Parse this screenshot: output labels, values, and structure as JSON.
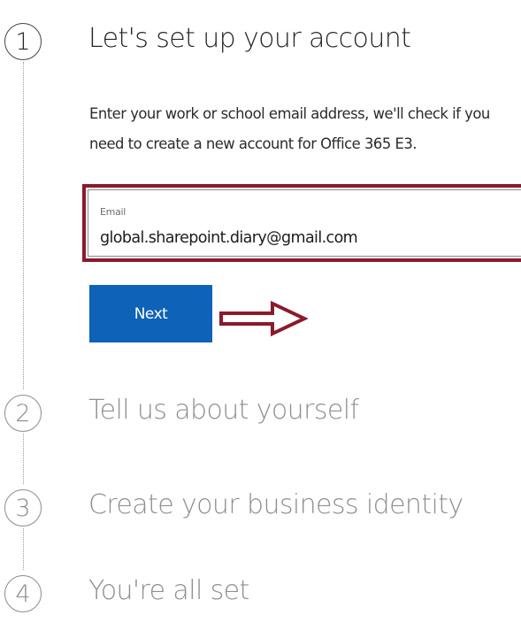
{
  "steps": [
    {
      "number": "1",
      "title": "Let's set up your account",
      "state": "active"
    },
    {
      "number": "2",
      "title": "Tell us about yourself",
      "state": "inactive"
    },
    {
      "number": "3",
      "title": "Create your business identity",
      "state": "inactive"
    },
    {
      "number": "4",
      "title": "You're all set",
      "state": "inactive"
    }
  ],
  "account_step": {
    "description": "Enter your work or school email address, we'll check if you need to create a new account for Office 365 E3.",
    "email_label": "Email",
    "email_value": "global.sharepoint.diary@gmail.com",
    "next_label": "Next"
  },
  "colors": {
    "primary_button": "#0e62b7",
    "highlight_border": "#8b1a2b",
    "arrow": "#8b1a2b",
    "inactive_text": "#8f8f8f"
  },
  "icons": {
    "arrow": "right-arrow-outline-icon"
  }
}
